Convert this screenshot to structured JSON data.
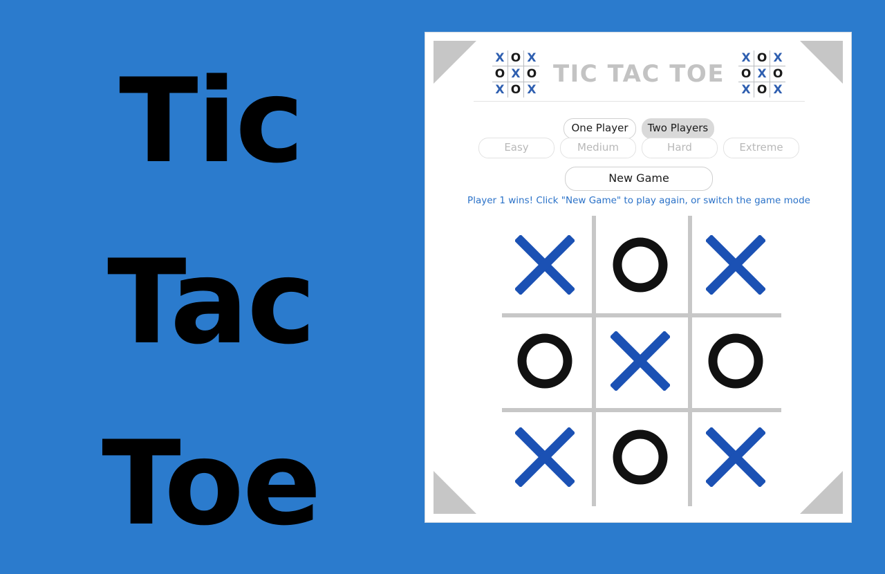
{
  "page": {
    "background_color": "#2b7bcd"
  },
  "brand": {
    "lines": [
      "Tic",
      "Tac",
      "Toe"
    ],
    "text_color": "#000000"
  },
  "card": {
    "background_color": "#ffffff",
    "corner_decoration_color": "#c6c6c6"
  },
  "header": {
    "title": "TIC TAC TOE",
    "title_color": "#c3c3c3",
    "logo_left_name": "logo-grid-left",
    "logo_right_name": "logo-grid-right",
    "logo_pattern": [
      "X",
      "O",
      "X",
      "O",
      "X",
      "O",
      "X",
      "O",
      "X"
    ],
    "logo_x_color": "#2f5fb0",
    "logo_o_color": "#1a1a1a"
  },
  "controls": {
    "mode_buttons": [
      {
        "label": "One Player",
        "selected": false,
        "disabled": false
      },
      {
        "label": "Two Players",
        "selected": true,
        "disabled": false
      }
    ],
    "difficulty_buttons": [
      {
        "label": "Easy",
        "selected": false,
        "disabled": true
      },
      {
        "label": "Medium",
        "selected": false,
        "disabled": true
      },
      {
        "label": "Hard",
        "selected": false,
        "disabled": true
      },
      {
        "label": "Extreme",
        "selected": false,
        "disabled": true
      }
    ],
    "new_game_label": "New Game"
  },
  "status": {
    "message": "Player 1 wins! Click \"New Game\" to play again, or switch the game mode",
    "color": "#2b72c8"
  },
  "board": {
    "grid_line_color": "#c7c7c7",
    "x_color": "#1b51b4",
    "o_color": "#111111",
    "cells": [
      {
        "row": 1,
        "col": 1,
        "mark": "X"
      },
      {
        "row": 1,
        "col": 2,
        "mark": "O"
      },
      {
        "row": 1,
        "col": 3,
        "mark": "X"
      },
      {
        "row": 2,
        "col": 1,
        "mark": "O"
      },
      {
        "row": 2,
        "col": 2,
        "mark": "X"
      },
      {
        "row": 2,
        "col": 3,
        "mark": "O"
      },
      {
        "row": 3,
        "col": 1,
        "mark": "X"
      },
      {
        "row": 3,
        "col": 2,
        "mark": "O"
      },
      {
        "row": 3,
        "col": 3,
        "mark": "X"
      }
    ]
  }
}
